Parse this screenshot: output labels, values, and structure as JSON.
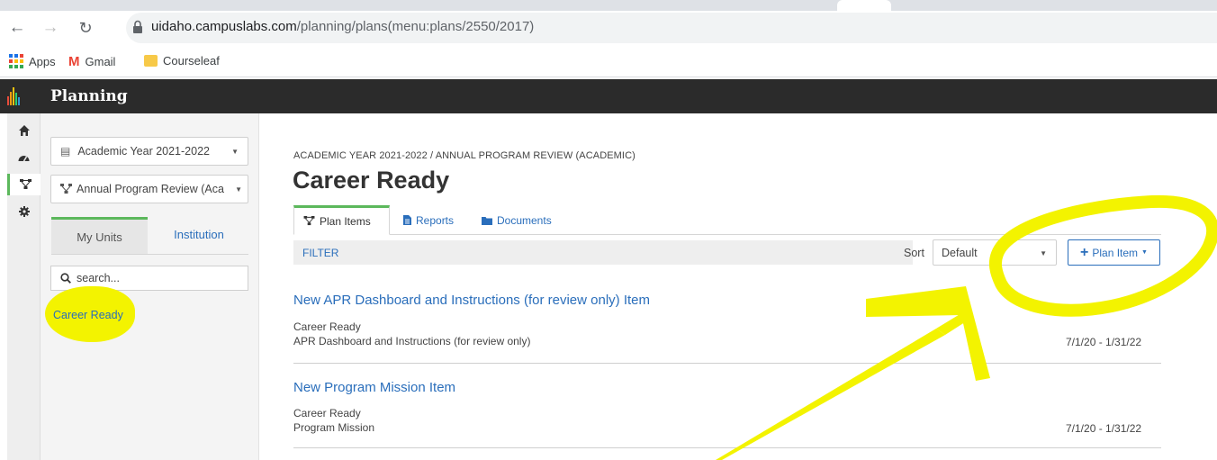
{
  "browser": {
    "url_host": "uidaho.campuslabs.com",
    "url_path": "/planning/plans(menu:plans/2550/2017)",
    "bookmarks": [
      "Apps",
      "Gmail",
      "Courseleaf"
    ]
  },
  "app": {
    "title": "Planning"
  },
  "rail": {
    "icons": [
      "home-icon",
      "dashboard-icon",
      "plans-icon",
      "settings-icon"
    ],
    "active": "plans-icon"
  },
  "sidebar": {
    "year_select": "Academic Year 2021-2022",
    "plan_select": "Annual Program Review (Aca",
    "tabs": [
      "My Units",
      "Institution"
    ],
    "search_placeholder": "search...",
    "units": [
      "Career Ready"
    ]
  },
  "main": {
    "breadcrumb": "ACADEMIC YEAR 2021-2022 / ANNUAL PROGRAM REVIEW (ACADEMIC)",
    "title": "Career Ready",
    "tabs": [
      "Plan Items",
      "Reports",
      "Documents"
    ],
    "filter_label": "FILTER",
    "sort_label": "Sort",
    "sort_value": "Default",
    "add_button": "Plan Item",
    "items": [
      {
        "title": "New APR Dashboard and Instructions (for review only) Item",
        "unit": "Career Ready",
        "subtitle": "APR Dashboard and Instructions (for review only)",
        "dates": "7/1/20 - 1/31/22"
      },
      {
        "title": "New Program Mission Item",
        "unit": "Career Ready",
        "subtitle": "Program Mission",
        "dates": "7/1/20 - 1/31/22"
      }
    ]
  },
  "colors": {
    "accent_green": "#5cb85c",
    "link_blue": "#2a6ebb",
    "header_dark": "#2b2b2b",
    "annotation_yellow": "#f3f300"
  }
}
